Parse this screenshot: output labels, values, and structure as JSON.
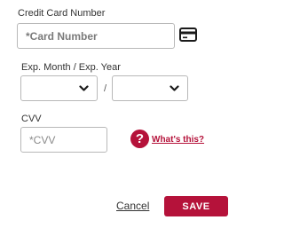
{
  "card_number": {
    "label": "Credit Card Number",
    "placeholder": "*Card Number",
    "icon": "credit-card-icon"
  },
  "expiry": {
    "label": "Exp. Month / Exp. Year",
    "separator": "/",
    "month_value": "",
    "year_value": "",
    "icon": "chevron-down-icon"
  },
  "cvv": {
    "label": "CVV",
    "placeholder": "*CVV",
    "help_icon_glyph": "?",
    "help_link": "What's this?"
  },
  "actions": {
    "cancel_label": "Cancel",
    "save_label": "SAVE"
  },
  "colors": {
    "accent": "#b5123a",
    "border": "#b8b8b8",
    "text": "#333333"
  }
}
